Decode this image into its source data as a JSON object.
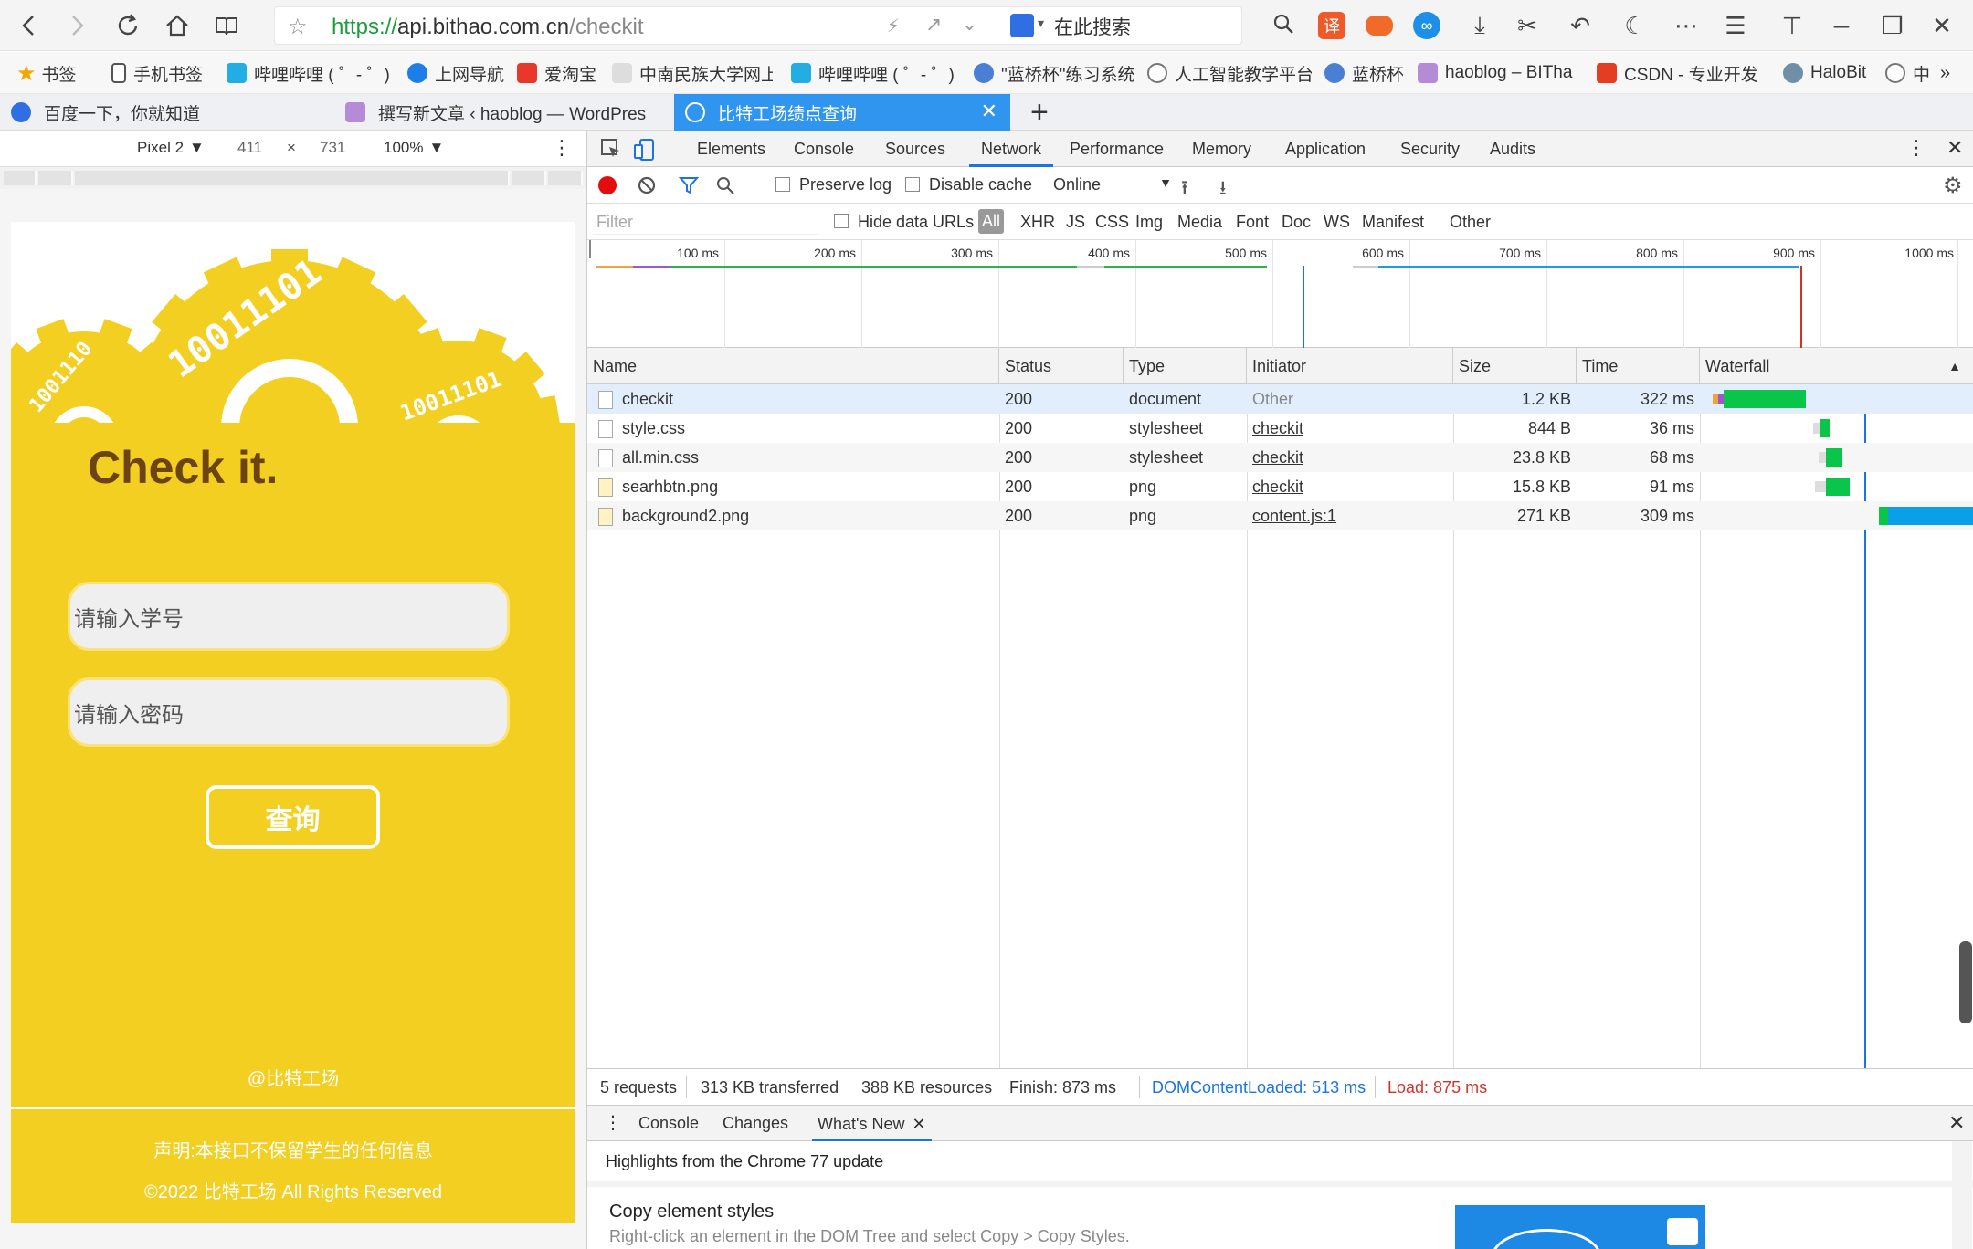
{
  "browser": {
    "url_scheme": "https://",
    "url_host": "api.bithao.com.cn",
    "url_path": "/checkit",
    "search_placeholder": "在此搜索"
  },
  "bookmarks": [
    {
      "label": "书签"
    },
    {
      "label": "手机书签"
    },
    {
      "label": "哔哩哔哩 ( ゜- ゜)つ"
    },
    {
      "label": "上网导航"
    },
    {
      "label": "爱淘宝"
    },
    {
      "label": "中南民族大学网上"
    },
    {
      "label": "哔哩哔哩 ( ゜- ゜)つ"
    },
    {
      "label": "\"蓝桥杯\"练习系统"
    },
    {
      "label": "人工智能教学平台"
    },
    {
      "label": "蓝桥杯"
    },
    {
      "label": "haoblog – BITha"
    },
    {
      "label": "CSDN - 专业开发"
    },
    {
      "label": "HaloBit"
    },
    {
      "label": "中"
    }
  ],
  "tabs": [
    {
      "label": "百度一下，你就知道"
    },
    {
      "label": "撰写新文章 ‹ haoblog — WordPres"
    },
    {
      "label": "比特工场绩点查询"
    }
  ],
  "device_toolbar": {
    "device": "Pixel 2",
    "width": "411",
    "height": "731",
    "zoom": "100%"
  },
  "page": {
    "title": "Check it.",
    "student_id_placeholder": "请输入学号",
    "password_placeholder": "请输入密码",
    "query_button": "查询",
    "credit": "@比特工场",
    "disclaimer": "声明:本接口不保留学生的任何信息",
    "copyright": "©2022 比特工场 All Rights Reserved",
    "gear_text_1": "10011101",
    "gear_text_2": "1001110",
    "gear_text_3": "10011101"
  },
  "devtools": {
    "panels": [
      "Elements",
      "Console",
      "Sources",
      "Network",
      "Performance",
      "Memory",
      "Application",
      "Security",
      "Audits"
    ],
    "active_panel": "Network",
    "preserve_log": "Preserve log",
    "disable_cache": "Disable cache",
    "throttling": "Online",
    "filter_placeholder": "Filter",
    "hide_data_urls": "Hide data URLs",
    "type_filters": [
      "All",
      "XHR",
      "JS",
      "CSS",
      "Img",
      "Media",
      "Font",
      "Doc",
      "WS",
      "Manifest",
      "Other"
    ],
    "overview_ticks": [
      "100 ms",
      "200 ms",
      "300 ms",
      "400 ms",
      "500 ms",
      "600 ms",
      "700 ms",
      "800 ms",
      "900 ms",
      "1000 ms"
    ],
    "columns": [
      "Name",
      "Status",
      "Type",
      "Initiator",
      "Size",
      "Time",
      "Waterfall"
    ],
    "requests": [
      {
        "name": "checkit",
        "status": "200",
        "type": "document",
        "initiator": "Other",
        "size": "1.2 KB",
        "time": "322 ms"
      },
      {
        "name": "style.css",
        "status": "200",
        "type": "stylesheet",
        "initiator": "checkit",
        "size": "844 B",
        "time": "36 ms"
      },
      {
        "name": "all.min.css",
        "status": "200",
        "type": "stylesheet",
        "initiator": "checkit",
        "size": "23.8 KB",
        "time": "68 ms"
      },
      {
        "name": "searhbtn.png",
        "status": "200",
        "type": "png",
        "initiator": "checkit",
        "size": "15.8 KB",
        "time": "91 ms"
      },
      {
        "name": "background2.png",
        "status": "200",
        "type": "png",
        "initiator": "content.js:1",
        "size": "271 KB",
        "time": "309 ms"
      }
    ],
    "summary": {
      "requests": "5 requests",
      "transferred": "313 KB transferred",
      "resources": "388 KB resources",
      "finish": "Finish: 873 ms",
      "dom_content_loaded": "DOMContentLoaded: 513 ms",
      "load": "Load: 875 ms"
    },
    "drawer_tabs": [
      "Console",
      "Changes",
      "What's New"
    ],
    "drawer_active": "What's New",
    "drawer_heading": "Highlights from the Chrome 77 update",
    "drawer_item_title": "Copy element styles",
    "drawer_item_desc": "Right-click an element in the DOM Tree and select Copy > Copy Styles."
  },
  "colors": {
    "page_yellow": "#f3cf22",
    "title_brown": "#6b4412",
    "tab_active_blue": "#2f95ee",
    "waterfall_green": "#0bc44a",
    "waterfall_blue": "#0aa0e6",
    "dcl_blue": "#1a73e8",
    "load_red": "#d93025"
  }
}
